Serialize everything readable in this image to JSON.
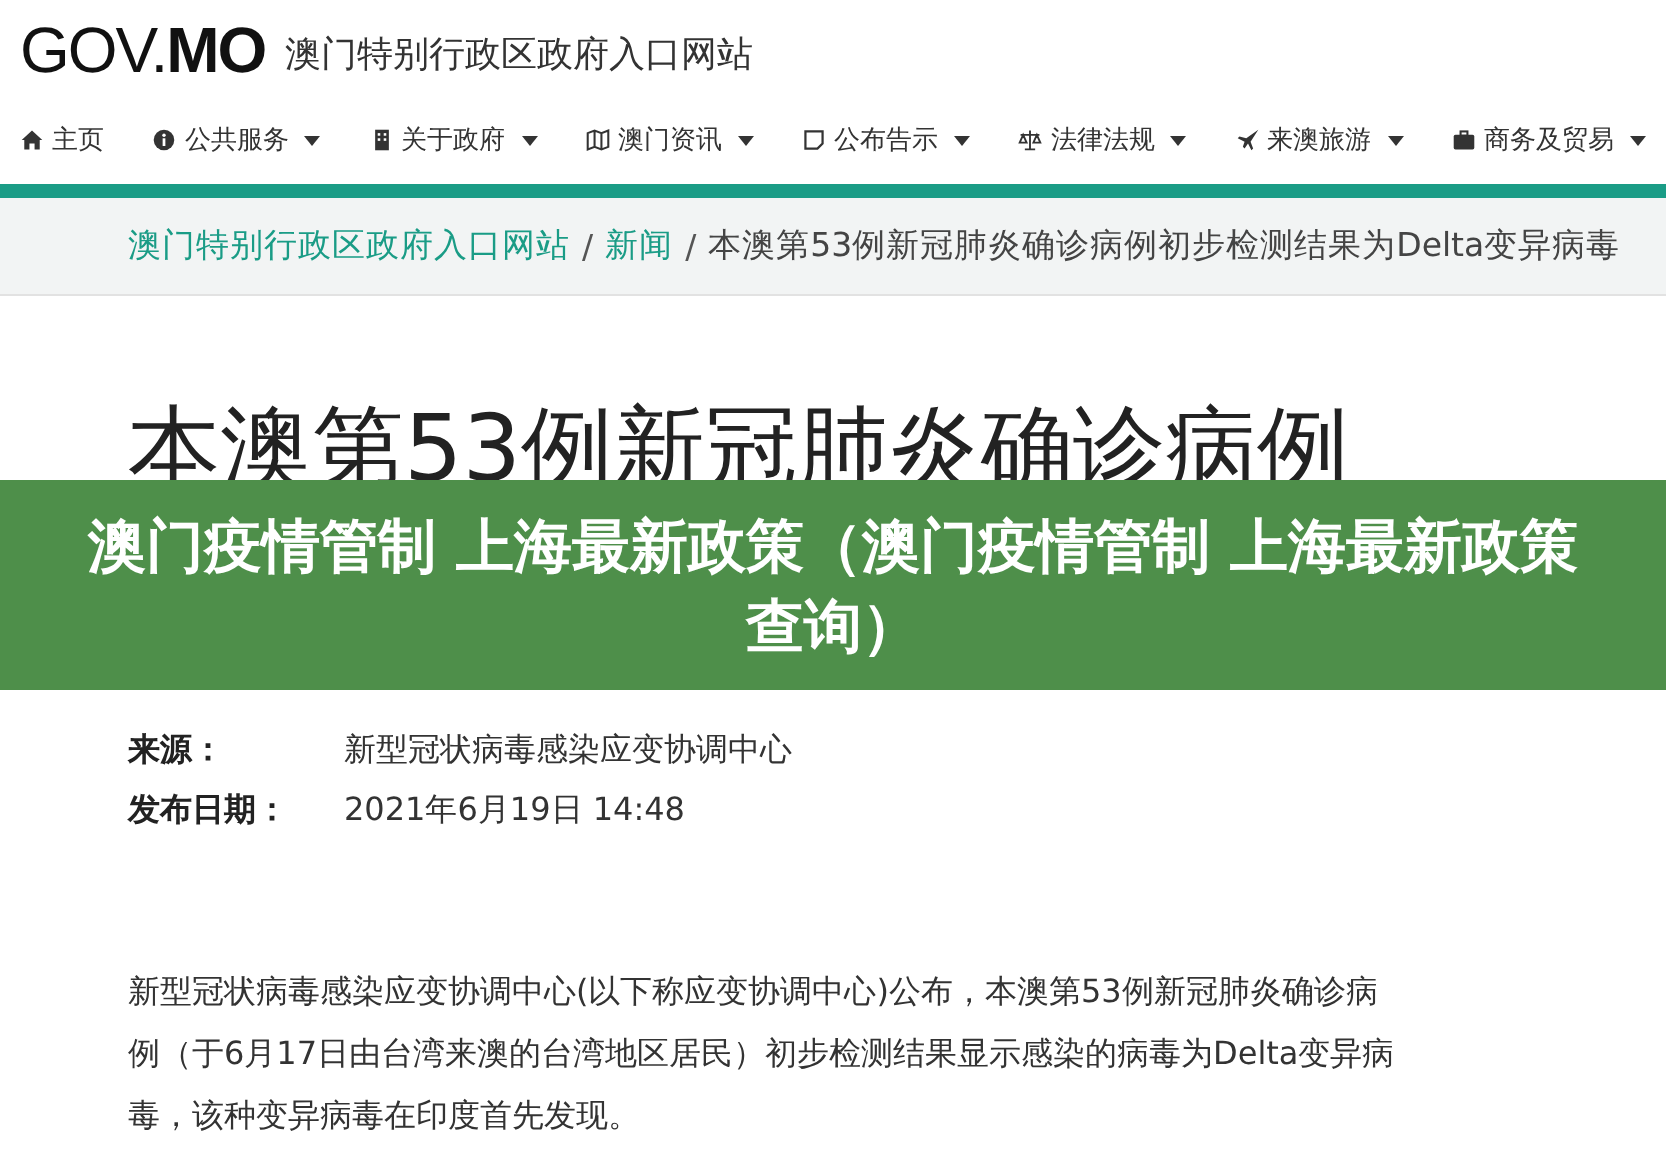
{
  "header": {
    "logo": "GOV.MO",
    "site_name": "澳门特别行政区政府入口网站"
  },
  "nav": [
    {
      "kind": "home",
      "label": "主页",
      "dropdown": false
    },
    {
      "kind": "info",
      "label": "公共服务",
      "dropdown": true
    },
    {
      "kind": "building",
      "label": "关于政府",
      "dropdown": true
    },
    {
      "kind": "map",
      "label": "澳门资讯",
      "dropdown": true
    },
    {
      "kind": "note",
      "label": "公布告示",
      "dropdown": true
    },
    {
      "kind": "scales",
      "label": "法律法规",
      "dropdown": true
    },
    {
      "kind": "plane",
      "label": "来澳旅游",
      "dropdown": true
    },
    {
      "kind": "briefcase",
      "label": "商务及贸易",
      "dropdown": true
    }
  ],
  "breadcrumb_separator": "/",
  "breadcrumb": [
    {
      "label": "澳门特别行政区政府入口网站",
      "link": true
    },
    {
      "label": "新闻",
      "link": true
    },
    {
      "label": "本澳第53例新冠肺炎确诊病例初步检测结果为Delta变异病毒",
      "link": false
    }
  ],
  "heading": "本澳第53例新冠肺炎确诊病例",
  "banner": "澳门疫情管制 上海最新政策（澳门疫情管制 上海最新政策查询）",
  "meta": [
    {
      "label": "来源：",
      "value": "新型冠状病毒感染应变协调中心"
    },
    {
      "label": "发布日期：",
      "value": "2021年6月19日 14:48"
    }
  ],
  "body": "新型冠状病毒感染应变协调中心(以下称应变协调中心)公布，本澳第53例新冠肺炎确诊病例（于6月17日由台湾来澳的台湾地区居民）初步检测结果显示感染的病毒为Delta变异病毒，该种变异病毒在印度首先发现。"
}
